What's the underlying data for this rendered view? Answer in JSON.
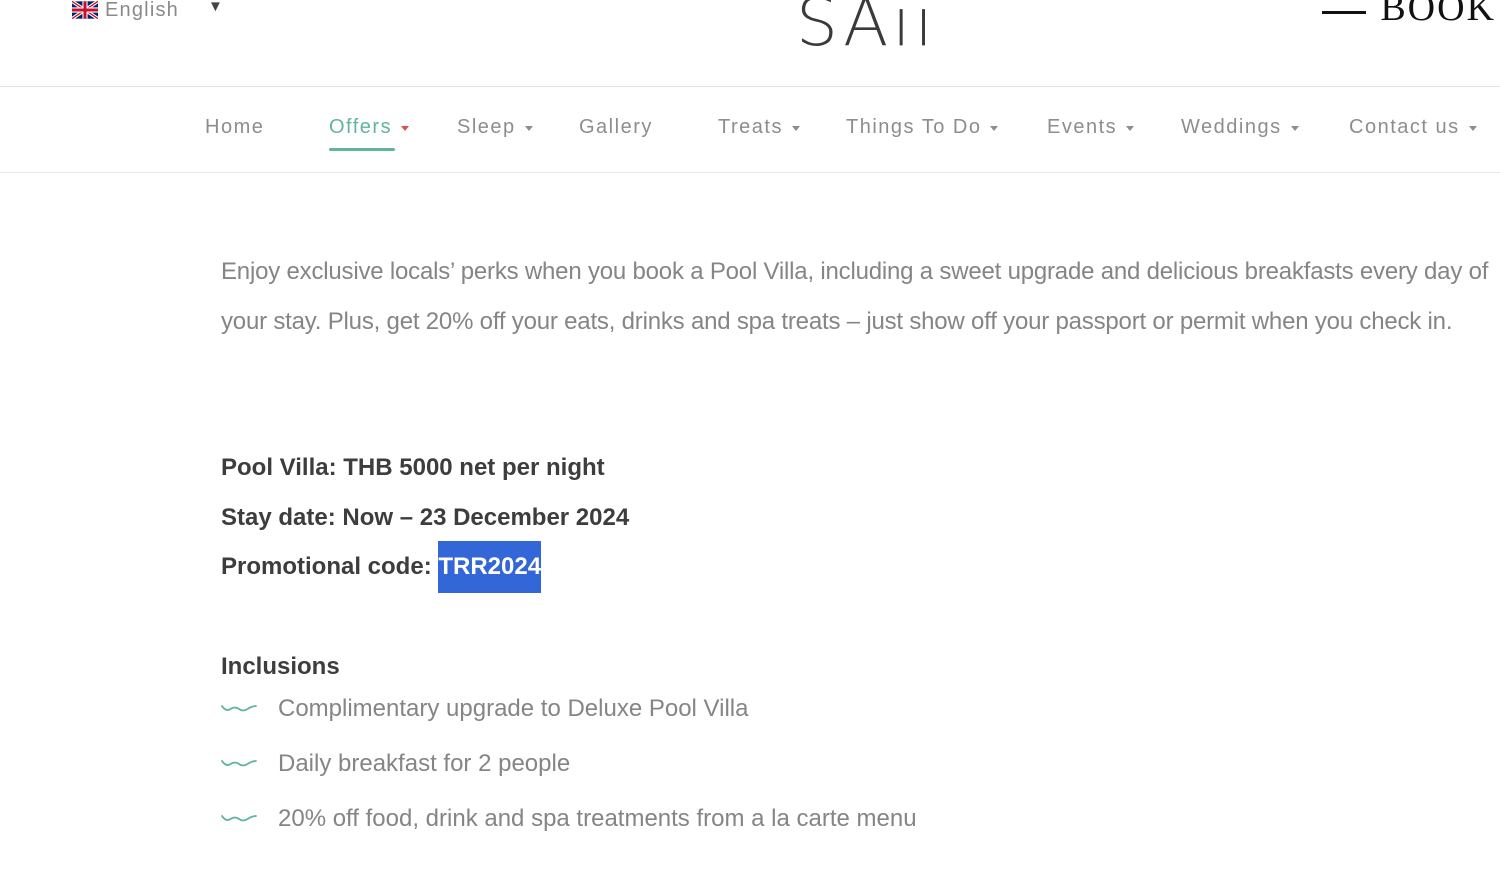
{
  "language": {
    "label": "English",
    "flag_icon": "uk-flag-icon"
  },
  "logo": "SAii",
  "book_label": "BOOK",
  "nav": {
    "items": [
      {
        "label": "Home",
        "has_dropdown": false
      },
      {
        "label": "Offers",
        "has_dropdown": true,
        "active": true
      },
      {
        "label": "Sleep",
        "has_dropdown": true
      },
      {
        "label": "Gallery",
        "has_dropdown": false
      },
      {
        "label": "Treats",
        "has_dropdown": true
      },
      {
        "label": "Things To Do",
        "has_dropdown": true
      },
      {
        "label": "Events",
        "has_dropdown": true
      },
      {
        "label": "Weddings",
        "has_dropdown": true
      },
      {
        "label": "Contact us",
        "has_dropdown": true
      }
    ]
  },
  "content": {
    "intro": "Enjoy exclusive locals’ perks when you book a Pool Villa, including a sweet upgrade and delicious breakfasts every day of your stay. Plus, get 20% off your eats, drinks and spa treats – just show off your passport or permit when you check in.",
    "pool_villa": "Pool Villa: THB 5000 net per night",
    "stay_date": "Stay date: Now – 23 December 2024",
    "promo_label": "Promotional code: ",
    "promo_code": "TRR2024",
    "inclusions_title": "Inclusions",
    "inclusions": [
      "Complimentary upgrade to Deluxe Pool Villa",
      "Daily breakfast for 2 people",
      "20% off food, drink and spa treatments from a la carte menu"
    ]
  },
  "colors": {
    "accent": "#5fb5a0",
    "selection": "#3366d6",
    "text_muted": "#858585",
    "text_strong": "#3d3d3d"
  }
}
